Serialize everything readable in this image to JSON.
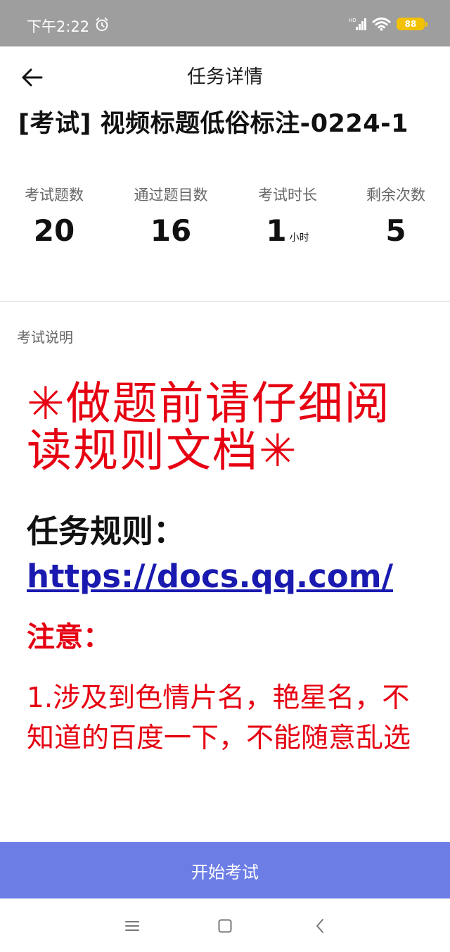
{
  "status_bar": {
    "time": "下午2:22",
    "battery": "88",
    "icons": [
      "alarm-icon",
      "signal-icon",
      "wifi-icon",
      "battery-icon"
    ]
  },
  "header": {
    "title": "任务详情",
    "back_icon": "arrow-left-icon"
  },
  "task": {
    "title": "[考试]  视频标题低俗标注-0224-1"
  },
  "stats": [
    {
      "label": "考试题数",
      "value": "20",
      "unit": ""
    },
    {
      "label": "通过题目数",
      "value": "16",
      "unit": ""
    },
    {
      "label": "考试时长",
      "value": "1",
      "unit": "小时"
    },
    {
      "label": "剩余次数",
      "value": "5",
      "unit": ""
    }
  ],
  "description": {
    "section_label": "考试说明",
    "headline": "✳做题前请仔细阅读规则文档✳",
    "rule_label": "任务规则：",
    "rule_link": "https://docs.qq.com/",
    "notice_heading": "注意：",
    "notice_body": "1.涉及到色情片名，艳星名，不知道的百度一下，不能随意乱选"
  },
  "actions": {
    "start_label": "开始考试"
  },
  "nav_bar": {
    "icons": [
      "menu-icon",
      "home-square-icon",
      "back-chevron-icon"
    ]
  },
  "colors": {
    "status_bar": "#9e9e9e",
    "accent_red": "#e60012",
    "link_blue": "#1a1ab0",
    "start_button": "#6c7de6",
    "battery": "#f2c100"
  }
}
